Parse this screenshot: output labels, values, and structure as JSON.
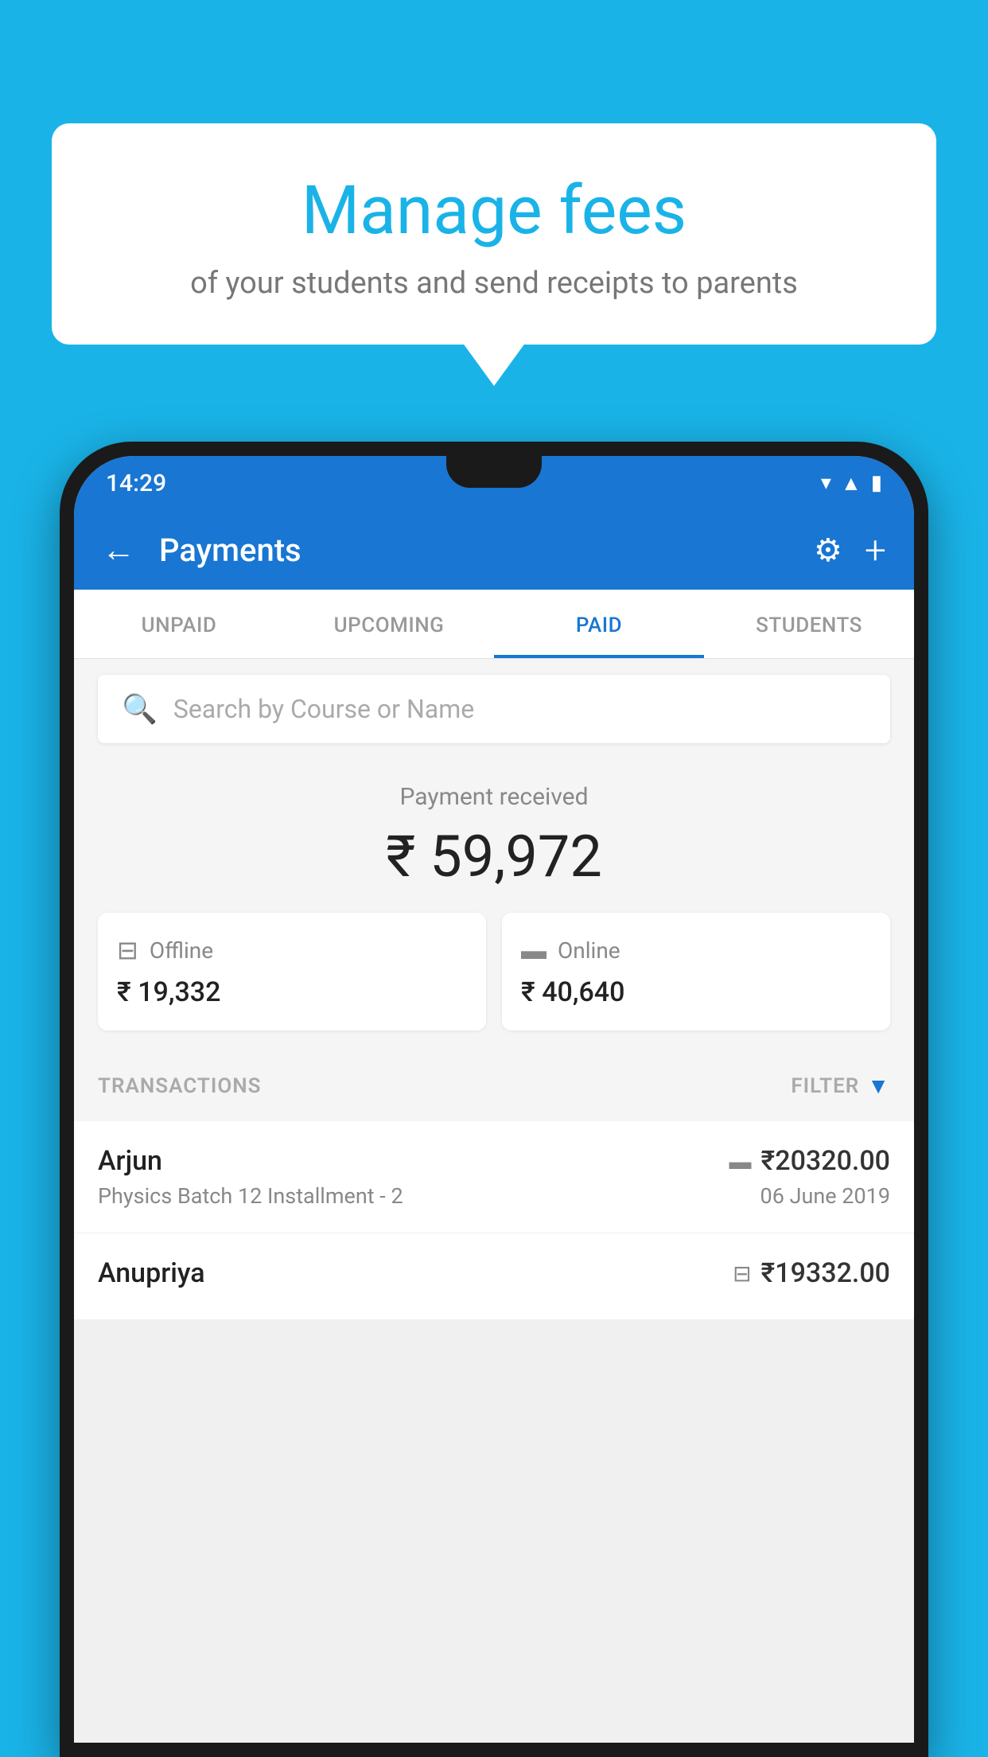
{
  "background_color": "#1ab3e8",
  "speech_bubble": {
    "heading": "Manage fees",
    "subtext": "of your students and send receipts to parents"
  },
  "status_bar": {
    "time": "14:29",
    "icons": [
      "wifi",
      "signal",
      "battery"
    ]
  },
  "app_header": {
    "title": "Payments",
    "back_label": "←",
    "settings_icon": "⚙",
    "add_icon": "+"
  },
  "tabs": [
    {
      "label": "UNPAID",
      "active": false
    },
    {
      "label": "UPCOMING",
      "active": false
    },
    {
      "label": "PAID",
      "active": true
    },
    {
      "label": "STUDENTS",
      "active": false
    }
  ],
  "search": {
    "placeholder": "Search by Course or Name"
  },
  "payment_summary": {
    "label": "Payment received",
    "total_amount": "₹ 59,972",
    "offline": {
      "type": "Offline",
      "amount": "₹ 19,332"
    },
    "online": {
      "type": "Online",
      "amount": "₹ 40,640"
    }
  },
  "transactions": {
    "section_label": "TRANSACTIONS",
    "filter_label": "FILTER",
    "items": [
      {
        "name": "Arjun",
        "course": "Physics Batch 12 Installment - 2",
        "amount": "₹20320.00",
        "date": "06 June 2019",
        "payment_type": "online"
      },
      {
        "name": "Anupriya",
        "course": "",
        "amount": "₹19332.00",
        "date": "",
        "payment_type": "offline"
      }
    ]
  }
}
